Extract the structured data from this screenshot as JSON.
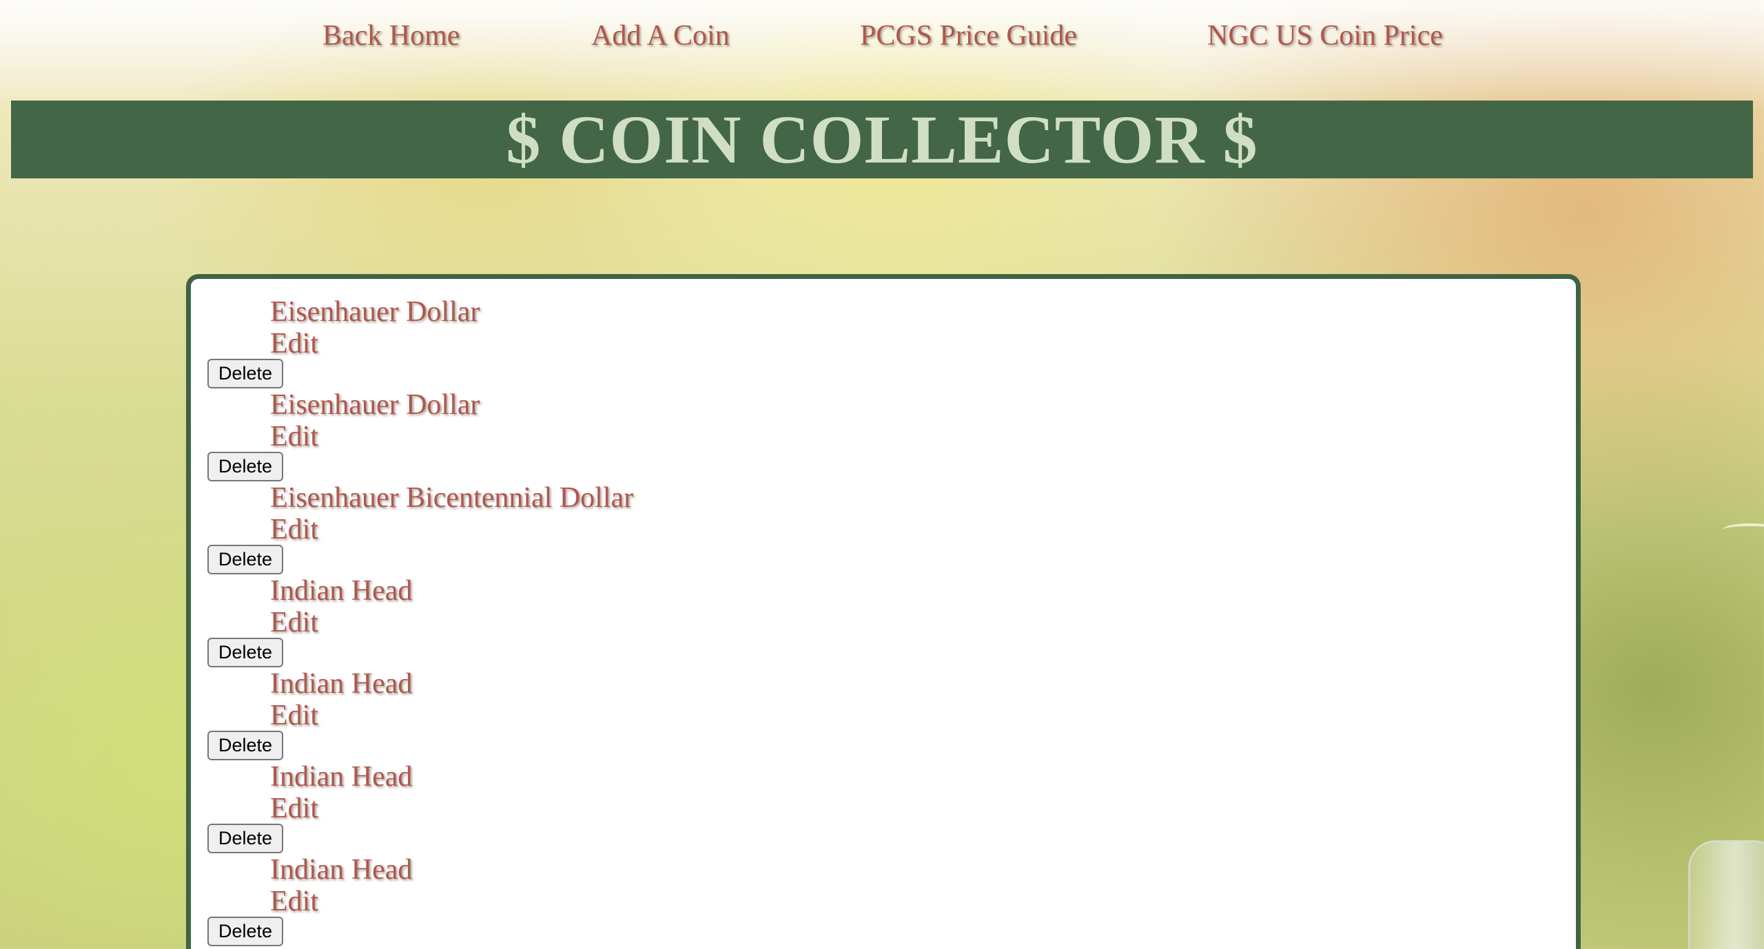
{
  "nav": {
    "home_label": "Back Home",
    "add_label": "Add A Coin",
    "pcgs_label": "PCGS Price Guide",
    "ngc_label": "NGC US Coin Price"
  },
  "banner": {
    "title": "$ COIN COLLECTOR $"
  },
  "coins": [
    {
      "name": "Eisenhauer Dollar",
      "edit_label": "Edit",
      "delete_label": "Delete"
    },
    {
      "name": "Eisenhauer Dollar",
      "edit_label": "Edit",
      "delete_label": "Delete"
    },
    {
      "name": "Eisenhauer Bicentennial Dollar",
      "edit_label": "Edit",
      "delete_label": "Delete"
    },
    {
      "name": "Indian Head",
      "edit_label": "Edit",
      "delete_label": "Delete"
    },
    {
      "name": "Indian Head",
      "edit_label": "Edit",
      "delete_label": "Delete"
    },
    {
      "name": "Indian Head",
      "edit_label": "Edit",
      "delete_label": "Delete"
    },
    {
      "name": "Indian Head",
      "edit_label": "Edit",
      "delete_label": "Delete"
    }
  ],
  "colors": {
    "banner_bg": "#436746",
    "banner_text": "#d0dfc3",
    "link": "#b0574b",
    "panel_border": "#3f6443"
  }
}
